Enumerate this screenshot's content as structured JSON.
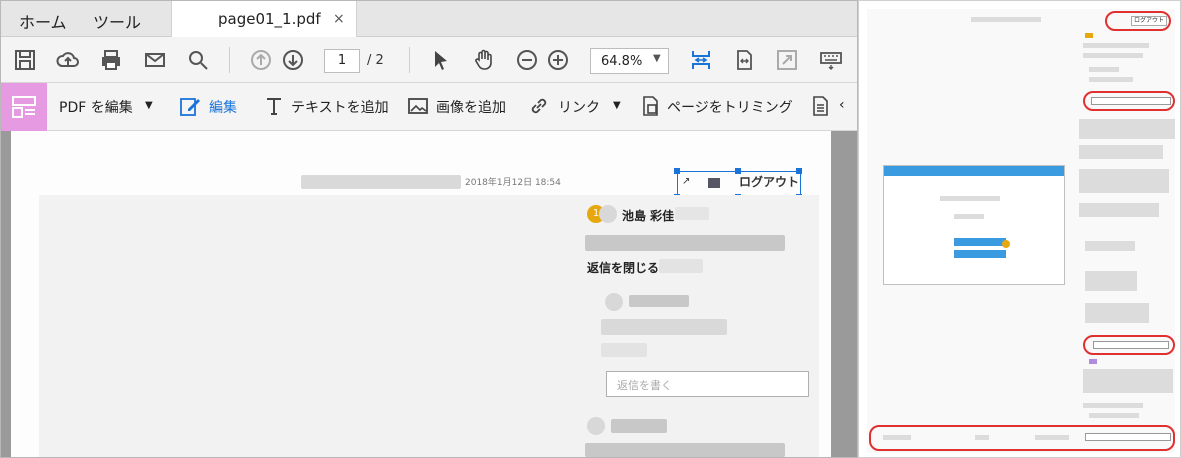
{
  "tabs": {
    "home": "ホーム",
    "tools": "ツール",
    "document": "page01_1.pdf",
    "close": "×"
  },
  "toolbar": {
    "page_current": "1",
    "page_total": "/ 2",
    "zoom": "64.8%"
  },
  "edit_bar": {
    "edit_pdf": "PDF を編集",
    "edit": "編集",
    "add_text": "テキストを追加",
    "add_image": "画像を追加",
    "link": "リンク",
    "crop": "ページをトリミング"
  },
  "page": {
    "date_header": "2018年1月12日 18:54",
    "logout": "ログアウト",
    "badge_count": "1",
    "user_name": "池島 彩佳",
    "close_reply": "返信を閉じる",
    "reply_placeholder": "返信を書く"
  },
  "thumbnail": {
    "logout": "ログアウト"
  },
  "colors": {
    "accent": "#1a73d9",
    "edit_panel": "#e69ae2",
    "badge": "#e6a80c",
    "highlight_ring": "#e03030"
  }
}
